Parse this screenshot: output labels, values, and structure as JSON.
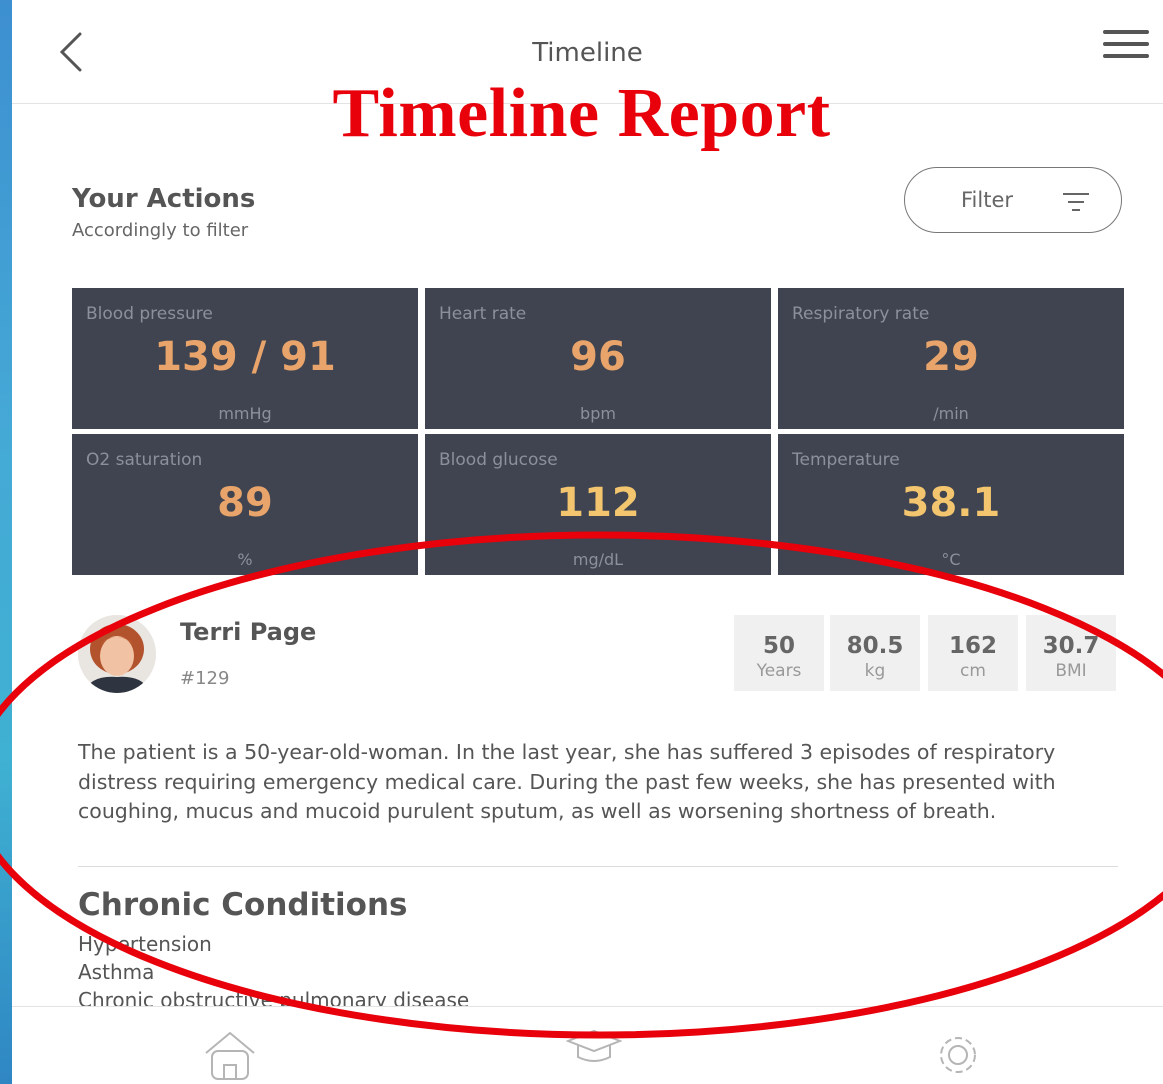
{
  "header": {
    "title": "Timeline",
    "overlay_title": "Timeline Report",
    "back_icon": "chevron-left-icon",
    "menu_icon": "hamburger-menu-icon"
  },
  "actions": {
    "title": "Your Actions",
    "subtitle": "Accordingly to filter",
    "filter_label": "Filter",
    "filter_icon": "filter-icon"
  },
  "vitals": [
    {
      "label": "Blood pressure",
      "value": "139 / 91",
      "unit": "mmHg",
      "color": "#e8a46a"
    },
    {
      "label": "Heart rate",
      "value": "96",
      "unit": "bpm",
      "color": "#e8a46a"
    },
    {
      "label": "Respiratory rate",
      "value": "29",
      "unit": "/min",
      "color": "#e8a46a"
    },
    {
      "label": "O2 saturation",
      "value": "89",
      "unit": "%",
      "color": "#e8a46a"
    },
    {
      "label": "Blood glucose",
      "value": "112",
      "unit": "mg/dL",
      "color": "#f2c56e"
    },
    {
      "label": "Temperature",
      "value": "38.1",
      "unit": "°C",
      "color": "#f2c56e"
    }
  ],
  "patient": {
    "name": "Terri Page",
    "id": "#129",
    "stats": [
      {
        "value": "50",
        "unit": "Years"
      },
      {
        "value": "80.5",
        "unit": "kg"
      },
      {
        "value": "162",
        "unit": "cm"
      },
      {
        "value": "30.7",
        "unit": "BMI"
      }
    ],
    "description": "The patient is a 50-year-old-woman. In the last year, she has suffered 3 episodes of respiratory distress requiring emergency medical care. During the past few weeks, she has presented with coughing, mucus and mucoid purulent sputum, as well as worsening shortness of breath."
  },
  "chronic_conditions": {
    "title": "Chronic Conditions",
    "items": [
      "Hypertension",
      "Asthma",
      "Chronic obstructive pulmonary disease"
    ]
  },
  "tabbar": {
    "items": [
      "home-icon",
      "graduation-cap-icon",
      "settings-gear-icon"
    ]
  },
  "colors": {
    "annotation_red": "#e8000b",
    "vital_tile_bg": "#3f4450"
  }
}
